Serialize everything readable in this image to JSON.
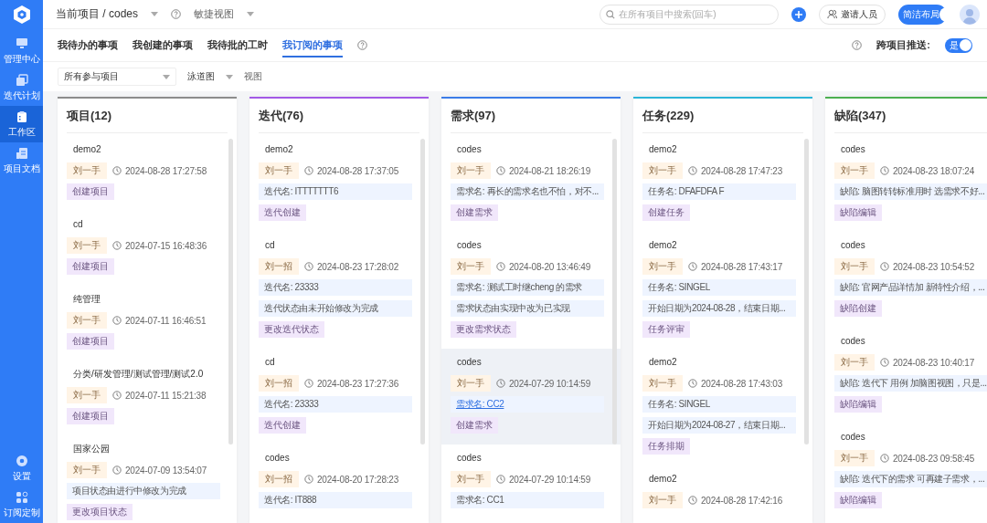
{
  "sidebar": {
    "items": [
      {
        "label": "管理中心",
        "selected": false
      },
      {
        "label": "迭代计划",
        "selected": false
      },
      {
        "label": "工作区",
        "selected": true
      },
      {
        "label": "项目文档",
        "selected": false
      }
    ],
    "bottom_items": [
      {
        "label": "设置",
        "selected": false
      },
      {
        "label": "订阅定制",
        "selected": false
      }
    ]
  },
  "topbar": {
    "breadcrumb": "当前项目 / codes",
    "view": "敏捷视图",
    "search": {
      "placeholder": "在所有项目中搜索(回车)"
    },
    "invite": "邀请人员",
    "layout_toggle": {
      "label": "简洁布局",
      "on": true
    }
  },
  "tabs": [
    {
      "label": "我待办的事项",
      "selected": false
    },
    {
      "label": "我创建的事项",
      "selected": false
    },
    {
      "label": "我待批的工时",
      "selected": false
    },
    {
      "label": "我订阅的事项",
      "selected": true
    }
  ],
  "push": {
    "label": "跨项目推送:",
    "switch_label": "是",
    "on": true
  },
  "filters": {
    "project": "所有参与项目",
    "view_type": "泳道图",
    "view_label": "视图"
  },
  "columns": [
    {
      "title": "项目(12)",
      "color": "#8c8c8c",
      "items": [
        {
          "project": "demo2",
          "user": "刘一手",
          "time": "2024-08-28 17:27:58",
          "action": "创建项目",
          "highlighted": false
        },
        {
          "project": "cd",
          "user": "刘一手",
          "time": "2024-07-15 16:48:36",
          "action": "创建项目",
          "highlighted": false
        },
        {
          "project": "纯管理",
          "user": "刘一手",
          "time": "2024-07-11 16:46:51",
          "action": "创建项目",
          "highlighted": false
        },
        {
          "project": "分类/研发管理/测试管理/测试2.0",
          "user": "刘一手",
          "time": "2024-07-11 15:21:38",
          "action": "创建项目",
          "highlighted": false
        },
        {
          "project": "国家公园",
          "user": "刘一手",
          "time": "2024-07-09 13:54:07",
          "details": [
            {
              "text": "项目状态由进行中修改为完成",
              "link": false
            }
          ],
          "action": "更改项目状态",
          "highlighted": false
        }
      ]
    },
    {
      "title": "迭代(76)",
      "color": "#a259e6",
      "items": [
        {
          "project": "demo2",
          "user": "刘一手",
          "time": "2024-08-28 17:37:05",
          "details": [
            {
              "text": "迭代名: ITTTTTTT6",
              "link": false
            }
          ],
          "action": "迭代创建",
          "highlighted": false
        },
        {
          "project": "cd",
          "user": "刘一招",
          "time": "2024-08-23 17:28:02",
          "details": [
            {
              "text": "迭代名: 23333",
              "link": false
            },
            {
              "text": "迭代状态由未开始修改为完成",
              "link": false
            }
          ],
          "action": "更改迭代状态",
          "highlighted": false
        },
        {
          "project": "cd",
          "user": "刘一招",
          "time": "2024-08-23 17:27:36",
          "details": [
            {
              "text": "迭代名: 23333",
              "link": false
            }
          ],
          "action": "迭代创建",
          "highlighted": false
        },
        {
          "project": "codes",
          "user": "刘一招",
          "time": "2024-08-20 17:28:23",
          "details": [
            {
              "text": "迭代名: IT888",
              "link": false
            }
          ],
          "highlighted": false
        }
      ]
    },
    {
      "title": "需求(97)",
      "color": "#3b7ce8",
      "items": [
        {
          "project": "codes",
          "user": "刘一手",
          "time": "2024-08-21 18:26:19",
          "details": [
            {
              "text": "需求名: 再长的需求名也不怕，对不...",
              "link": false
            }
          ],
          "action": "创建需求",
          "highlighted": false
        },
        {
          "project": "codes",
          "user": "刘一手",
          "time": "2024-08-20 13:46:49",
          "details": [
            {
              "text": "需求名: 测试工时继cheng 的需求",
              "link": false
            },
            {
              "text": "需求状态由实现中改为已实现",
              "link": false
            }
          ],
          "action": "更改需求状态",
          "highlighted": false
        },
        {
          "project": "codes",
          "user": "刘一手",
          "time": "2024-07-29 10:14:59",
          "details": [
            {
              "text": "需求名: CC2",
              "link": true
            }
          ],
          "action": "创建需求",
          "highlighted": true
        },
        {
          "project": "codes",
          "user": "刘一手",
          "time": "2024-07-29 10:14:59",
          "details": [
            {
              "text": "需求名: CC1",
              "link": false
            }
          ],
          "highlighted": false
        }
      ]
    },
    {
      "title": "任务(229)",
      "color": "#2bb5d8",
      "items": [
        {
          "project": "demo2",
          "user": "刘一手",
          "time": "2024-08-28 17:47:23",
          "details": [
            {
              "text": "任务名: DFAFDFA F",
              "link": false
            }
          ],
          "action": "创建任务",
          "highlighted": false
        },
        {
          "project": "demo2",
          "user": "刘一手",
          "time": "2024-08-28 17:43:17",
          "details": [
            {
              "text": "任务名: SINGEL",
              "link": false
            },
            {
              "text": "开始日期为2024-08-28，结束日期...",
              "link": false
            }
          ],
          "action": "任务评审",
          "highlighted": false
        },
        {
          "project": "demo2",
          "user": "刘一手",
          "time": "2024-08-28 17:43:03",
          "details": [
            {
              "text": "任务名: SINGEL",
              "link": false
            },
            {
              "text": "开始日期为2024-08-27，结束日期...",
              "link": false
            }
          ],
          "action": "任务排期",
          "highlighted": false
        },
        {
          "project": "demo2",
          "user": "刘一手",
          "time": "2024-08-28 17:42:16",
          "highlighted": false
        }
      ]
    },
    {
      "title": "缺陷(347)",
      "color": "#4caf50",
      "items": [
        {
          "project": "codes",
          "user": "刘一手",
          "time": "2024-08-23 18:07:24",
          "details": [
            {
              "text": "缺陷: 脑图转转标准用时 选需求不好...",
              "link": false
            }
          ],
          "action": "缺陷编辑",
          "highlighted": false
        },
        {
          "project": "codes",
          "user": "刘一手",
          "time": "2024-08-23 10:54:52",
          "details": [
            {
              "text": "缺陷: 官网产品详情加 新特性介绍，...",
              "link": false
            }
          ],
          "action": "缺陷创建",
          "highlighted": false
        },
        {
          "project": "codes",
          "user": "刘一手",
          "time": "2024-08-23 10:40:17",
          "details": [
            {
              "text": "缺陷: 迭代下 用例 加脑图视图，只是...",
              "link": false
            }
          ],
          "action": "缺陷编辑",
          "highlighted": false
        },
        {
          "project": "codes",
          "user": "刘一手",
          "time": "2024-08-23 09:58:45",
          "details": [
            {
              "text": "缺陷: 迭代下的需求 可再建子需求，...",
              "link": false
            }
          ],
          "action": "缺陷编辑",
          "highlighted": false
        }
      ]
    }
  ]
}
